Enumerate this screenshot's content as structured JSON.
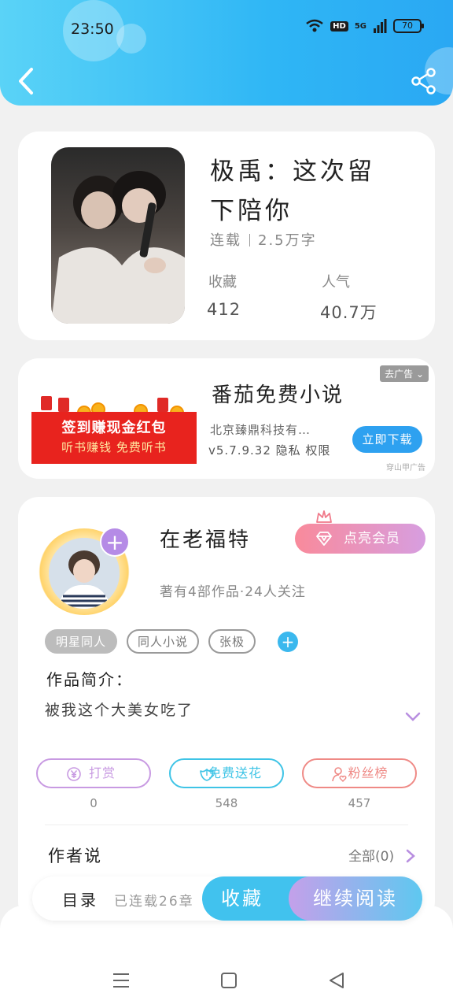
{
  "status_bar": {
    "time": "23:50",
    "network": "5G",
    "hd": "HD",
    "battery": "70"
  },
  "book": {
    "title": "极禹：这次留下陪你",
    "status": "连载",
    "word_count": "2.5万字",
    "collect_label": "收藏",
    "collect_value": "412",
    "popularity_label": "人气",
    "popularity_value": "40.7万"
  },
  "ad": {
    "banner_line1": "签到赚现金红包",
    "banner_line2": "听书赚钱  免费听书",
    "close_label": "去广告",
    "title": "番茄免费小说",
    "company": "北京臻鼎科技有…",
    "version": "v5.7.9.32 隐私 权限",
    "download_label": "立即下载",
    "source": "穿山甲广告"
  },
  "author": {
    "name": "在老福特",
    "meta": "著有4部作品·24人关注",
    "vip_label": "点亮会员",
    "tags": [
      "明星同人",
      "同人小说",
      "张极"
    ],
    "intro_label": "作品简介：",
    "intro_text": "被我这个大美女吃了",
    "actions": [
      {
        "label": "打赏",
        "count": "0",
        "color": "#c89ae2"
      },
      {
        "label": "免费送花",
        "count": "548",
        "color": "#3fc4e6"
      },
      {
        "label": "粉丝榜",
        "count": "457",
        "color": "#ef8a86"
      }
    ],
    "author_says_label": "作者说",
    "all_label": "全部(0)"
  },
  "bottom_bar": {
    "toc_label": "目录",
    "chapters": "已连载26章",
    "collect_label": "收藏",
    "read_label": "继续阅读"
  },
  "colors": {
    "header": "#2fb6f5",
    "accent_blue": "#41c2ee",
    "accent_purple": "#c4a0ea",
    "vip_pink": "#f98a9b"
  }
}
